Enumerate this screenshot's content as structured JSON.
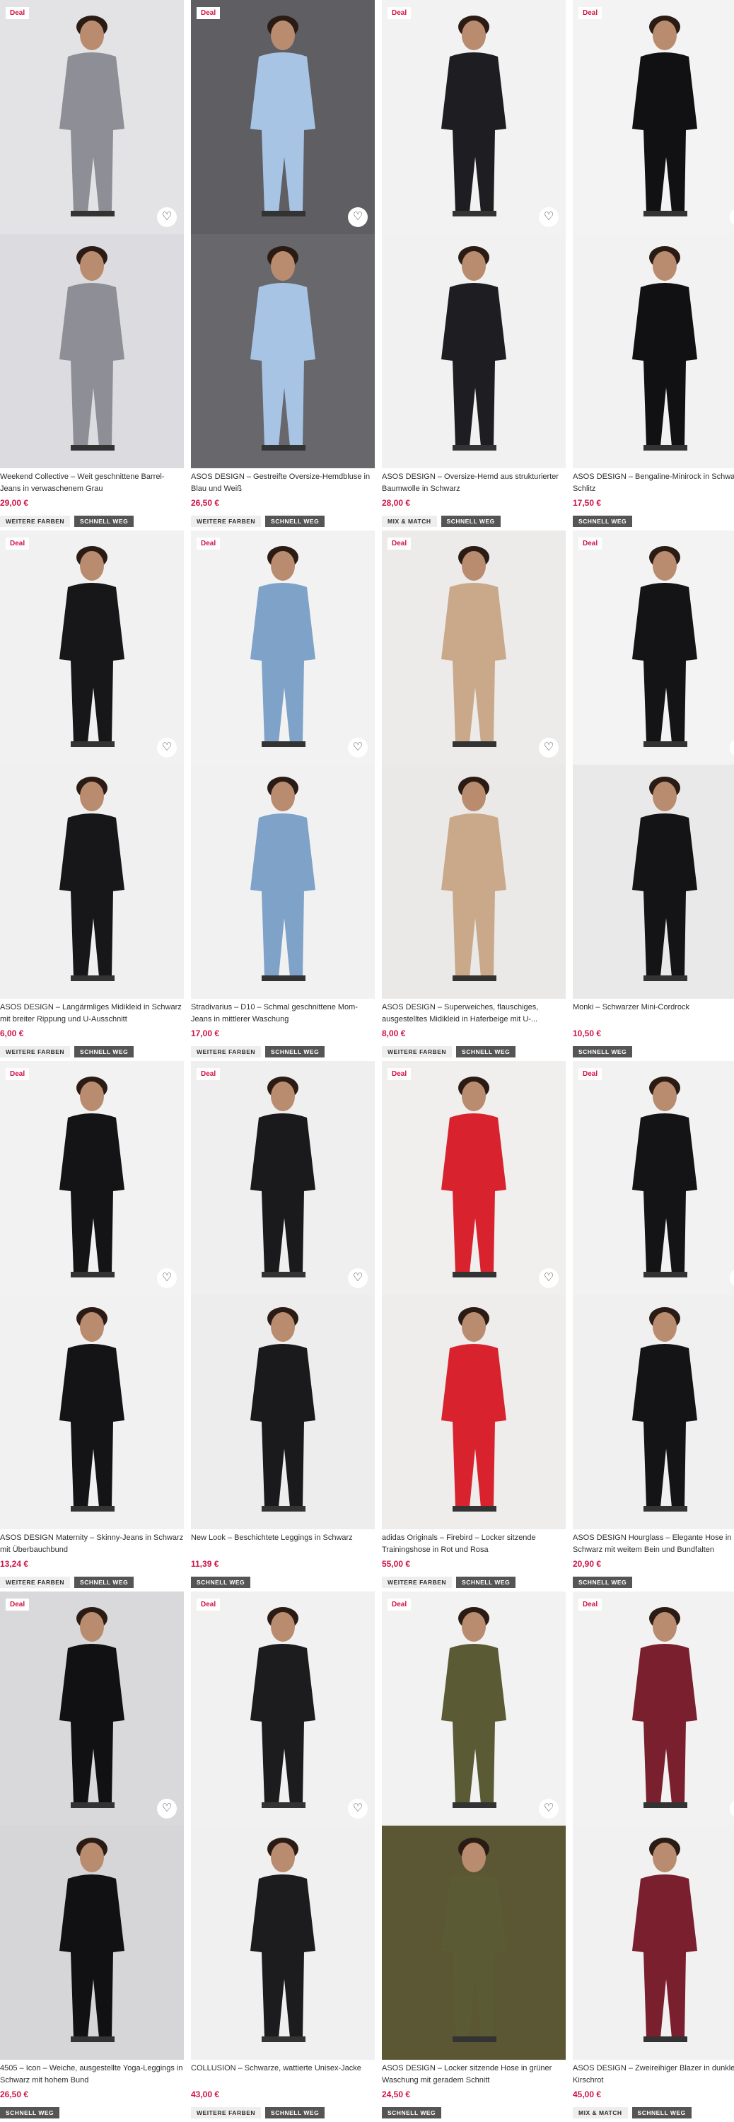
{
  "deal_label": "Deal",
  "colors": {
    "price": "#d01345",
    "deal": "#d01345",
    "tag_dark": "#555555",
    "tag_light": "#eeeeee"
  },
  "products": [
    {
      "title": "Weekend Collective – Weit geschnittene Barrel-Jeans in verwaschenem Grau",
      "price": "29,00 €",
      "deal": true,
      "tags": [
        "WEITERE FARBEN",
        "SCHNELL WEG"
      ],
      "bg_top": "#e3e3e6",
      "bg_bot": "#dcdce0",
      "tone": "#8e8e96"
    },
    {
      "title": "ASOS DESIGN – Gestreifte Oversize-Hemdbluse in Blau und Weiß",
      "price": "26,50 €",
      "deal": true,
      "tags": [
        "WEITERE FARBEN",
        "SCHNELL WEG"
      ],
      "bg_top": "#5e5e63",
      "bg_bot": "#67676c",
      "tone": "#a8c4e4"
    },
    {
      "title": "ASOS DESIGN – Oversize-Hemd aus strukturierter Baumwolle in Schwarz",
      "price": "28,00 €",
      "deal": true,
      "tags": [
        "MIX & MATCH",
        "SCHNELL WEG"
      ],
      "bg_top": "#f2f2f2",
      "bg_bot": "#f1f1f1",
      "tone": "#1e1e22"
    },
    {
      "title": "ASOS DESIGN – Bengaline-Minirock in Schwarz mit Schlitz",
      "price": "17,50 €",
      "deal": true,
      "tags": [
        "SCHNELL WEG"
      ],
      "bg_top": "#f3f3f3",
      "bg_bot": "#f2f2f2",
      "tone": "#111114"
    },
    {
      "title": "ASOS DESIGN – Langärmliges Midikleid in Schwarz mit breiter Rippung und U-Ausschnitt",
      "price": "6,00 €",
      "deal": true,
      "tags": [
        "WEITERE FARBEN",
        "SCHNELL WEG"
      ],
      "bg_top": "#f1f1f1",
      "bg_bot": "#f0f0f0",
      "tone": "#17171a"
    },
    {
      "title": "Stradivarius – D10 – Schmal geschnittene Mom-Jeans in mittlerer Waschung",
      "price": "17,00 €",
      "deal": true,
      "tags": [
        "WEITERE FARBEN",
        "SCHNELL WEG"
      ],
      "bg_top": "#f2f2f2",
      "bg_bot": "#f1f1f1",
      "tone": "#7fa2c8"
    },
    {
      "title": "ASOS DESIGN – Superweiches, flauschiges, ausgestelltes Midikleid in Haferbeige mit U-...",
      "price": "8,00 €",
      "deal": true,
      "tags": [
        "WEITERE FARBEN",
        "SCHNELL WEG"
      ],
      "bg_top": "#ecebea",
      "bg_bot": "#eae9e7",
      "tone": "#c9a98a"
    },
    {
      "title": "Monki – Schwarzer Mini-Cordrock",
      "price": "10,50 €",
      "deal": true,
      "tags": [
        "SCHNELL WEG"
      ],
      "bg_top": "#f3f3f3",
      "bg_bot": "#e9e9e9",
      "tone": "#141416"
    },
    {
      "title": "ASOS DESIGN Maternity – Skinny-Jeans in Schwarz mit Überbauchbund",
      "price": "13,24 €",
      "deal": true,
      "tags": [
        "WEITERE FARBEN",
        "SCHNELL WEG"
      ],
      "bg_top": "#f2f2f2",
      "bg_bot": "#f1f1f1",
      "tone": "#141416"
    },
    {
      "title": "New Look – Beschichtete Leggings in Schwarz",
      "price": "11,39 €",
      "deal": true,
      "tags": [
        "SCHNELL WEG"
      ],
      "bg_top": "#efefef",
      "bg_bot": "#ededed",
      "tone": "#1a1a1d"
    },
    {
      "title": "adidas Originals – Firebird – Locker sitzende Trainingshose in Rot und Rosa",
      "price": "55,00 €",
      "deal": true,
      "tags": [
        "WEITERE FARBEN",
        "SCHNELL WEG"
      ],
      "bg_top": "#f0efee",
      "bg_bot": "#eeedec",
      "tone": "#d8232f"
    },
    {
      "title": "ASOS DESIGN Hourglass – Elegante Hose in Schwarz mit weitem Bein und Bundfalten",
      "price": "20,90 €",
      "deal": true,
      "tags": [
        "SCHNELL WEG"
      ],
      "bg_top": "#f2f2f2",
      "bg_bot": "#f0f0f0",
      "tone": "#141416"
    },
    {
      "title": "4505 – Icon – Weiche, ausgestellte Yoga-Leggings in Schwarz mit hohem Bund",
      "price": "26,50 €",
      "deal": true,
      "tags": [
        "SCHNELL WEG"
      ],
      "bg_top": "#d9d9dc",
      "bg_bot": "#d6d6d9",
      "tone": "#111114"
    },
    {
      "title": "COLLUSION – Schwarze, wattierte Unisex-Jacke",
      "price": "43,00 €",
      "deal": true,
      "tags": [
        "WEITERE FARBEN",
        "SCHNELL WEG"
      ],
      "bg_top": "#f1f1f1",
      "bg_bot": "#f0f0f0",
      "tone": "#1c1c1f"
    },
    {
      "title": "ASOS DESIGN – Locker sitzende Hose in grüner Waschung mit geradem Schnitt",
      "price": "24,50 €",
      "deal": true,
      "tags": [
        "SCHNELL WEG"
      ],
      "bg_top": "#f2f2f2",
      "bg_bot": "#5b5633",
      "tone": "#5a5a34"
    },
    {
      "title": "ASOS DESIGN – Zweireihiger Blazer in dunklem Kirschrot",
      "price": "45,00 €",
      "deal": true,
      "tags": [
        "MIX & MATCH",
        "SCHNELL WEG"
      ],
      "bg_top": "#f2f2f2",
      "bg_bot": "#f1f1f1",
      "tone": "#7a1f2e"
    }
  ]
}
